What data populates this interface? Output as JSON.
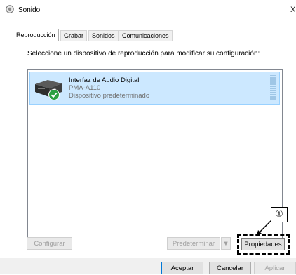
{
  "window": {
    "title": "Sonido",
    "icon": "speaker-icon",
    "close": "X"
  },
  "tabs": [
    {
      "label": "Reproducción",
      "active": true
    },
    {
      "label": "Grabar"
    },
    {
      "label": "Sonidos"
    },
    {
      "label": "Comunicaciones"
    }
  ],
  "instruction": "Seleccione un dispositivo de reproducción para modificar su configuración:",
  "device": {
    "name": "Interfaz de Audio Digital",
    "model": "PMA-A110",
    "status": "Dispositivo predeterminado",
    "icon": "receiver-icon",
    "badge": "check-icon"
  },
  "buttons": {
    "configure": "Configurar",
    "set_default": "Predeterminar",
    "default_arrow": "▼",
    "properties": "Propiedades",
    "accept": "Aceptar",
    "cancel": "Cancelar",
    "apply": "Aplicar"
  },
  "callout": "①",
  "colors": {
    "selection": "#cce8ff",
    "accent": "#0078d7",
    "check": "#2ea043"
  }
}
